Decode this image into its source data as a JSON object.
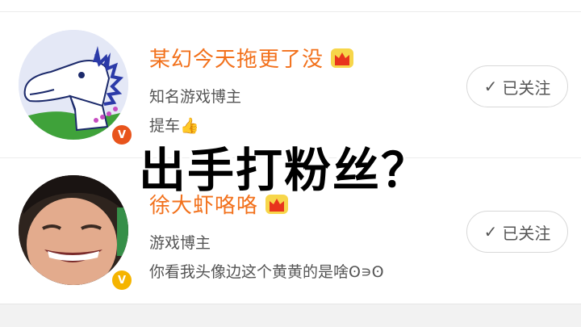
{
  "overlay": {
    "caption": "出手打粉丝？"
  },
  "users": [
    {
      "name": "某幻今天拖更了没",
      "verify": "知名游戏博主",
      "desc": "提车👍",
      "follow_label": "已关注",
      "badge": "V",
      "badge_color": "#e8541c"
    },
    {
      "name": "徐大虾咯咯",
      "verify": "游戏博主",
      "desc": "你看我头像边这个黄黄的是啥ʘ∍ʘ",
      "follow_label": "已关注",
      "badge": "V",
      "badge_color": "#f5b400"
    }
  ],
  "colors": {
    "name": "#f2711c",
    "text": "#555555",
    "divider": "#ececec"
  }
}
